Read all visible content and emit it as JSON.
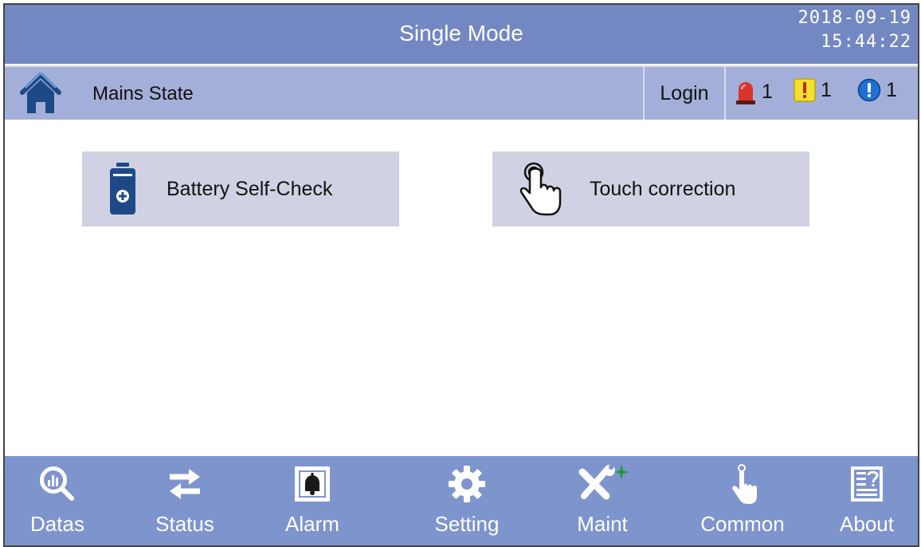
{
  "header": {
    "title": "Single Mode",
    "date": "2018-09-19",
    "time": "15:44:22"
  },
  "subheader": {
    "state_label": "Mains State",
    "login_label": "Login",
    "alarms": {
      "critical_count": "1",
      "warning_count": "1",
      "info_count": "1"
    }
  },
  "main": {
    "buttons": [
      {
        "label": "Battery Self-Check",
        "icon": "battery-plus-icon"
      },
      {
        "label": "Touch correction",
        "icon": "touch-hand-icon"
      }
    ]
  },
  "nav": {
    "items": [
      {
        "label": "Datas",
        "icon": "data-magnifier-icon"
      },
      {
        "label": "Status",
        "icon": "arrows-exchange-icon"
      },
      {
        "label": "Alarm",
        "icon": "bell-icon"
      },
      {
        "label": "Setting",
        "icon": "gear-icon"
      },
      {
        "label": "Maint",
        "icon": "wrench-screwdriver-icon"
      },
      {
        "label": "Common",
        "icon": "pointer-hand-icon"
      },
      {
        "label": "About",
        "icon": "about-document-icon"
      }
    ]
  },
  "colors": {
    "title_bar": "#7388c2",
    "sub_bar": "#a4afd9",
    "nav_bar": "#7e94cd",
    "button_bg": "#d0d2e3",
    "icon_dark_blue": "#1d4a86",
    "alarm_red": "#d9362b",
    "alarm_yellow": "#f2e02a",
    "alarm_blue": "#1e6fd6",
    "maint_plus_green": "#1f9b3a"
  }
}
